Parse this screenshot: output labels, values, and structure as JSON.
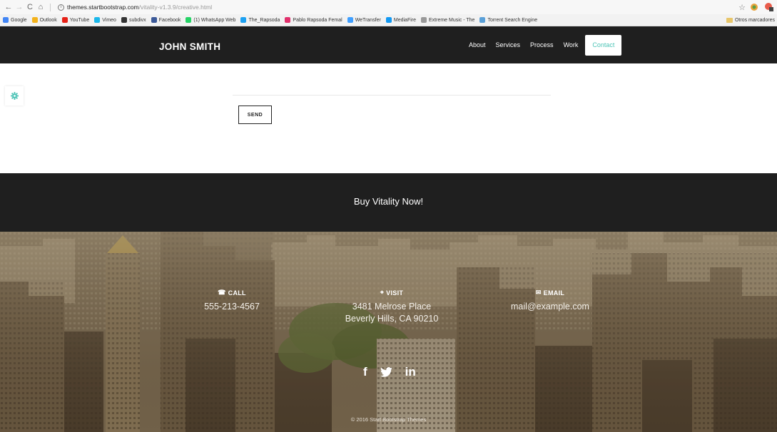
{
  "browser": {
    "url_host": "themes.startbootstrap.com",
    "url_path": "/vitality-v1.3.9/creative.html",
    "bookmarks": [
      {
        "label": "Google",
        "color": "#4285f4"
      },
      {
        "label": "Outlook",
        "color": "#f3b21b"
      },
      {
        "label": "YouTube",
        "color": "#e62117"
      },
      {
        "label": "Vimeo",
        "color": "#1ab7ea"
      },
      {
        "label": "subdivx",
        "color": "#333333"
      },
      {
        "label": "Facebook",
        "color": "#3b5998"
      },
      {
        "label": "(1) WhatsApp Web",
        "color": "#25d366"
      },
      {
        "label": "The_Rapsoda",
        "color": "#1da1f2"
      },
      {
        "label": "Pablo Rapsoda Femal",
        "color": "#e1306c"
      },
      {
        "label": "WeTransfer",
        "color": "#409fff"
      },
      {
        "label": "MediaFire",
        "color": "#1299f3"
      },
      {
        "label": "Extreme Music - The",
        "color": "#999999"
      },
      {
        "label": "Torrent Search Engine",
        "color": "#5aa0d8"
      }
    ],
    "other_bookmarks": "Otros marcadores"
  },
  "nav": {
    "brand": "JOHN SMITH",
    "links": [
      "About",
      "Services",
      "Process",
      "Work"
    ],
    "active_link": "Contact"
  },
  "form": {
    "send_label": "SEND"
  },
  "buy": {
    "text": "Buy Vitality Now!"
  },
  "footer": {
    "call_label": "CALL",
    "call_value": "555-213-4567",
    "visit_label": "VISIT",
    "visit_line1": "3481 Melrose Place",
    "visit_line2": "Beverly Hills, CA 90210",
    "email_label": "EMAIL",
    "email_value": "mail@example.com",
    "copyright": "© 2016 Start Bootstrap Themes"
  },
  "colors": {
    "dark": "#1f1f1f",
    "accent": "#4ec4b7"
  }
}
